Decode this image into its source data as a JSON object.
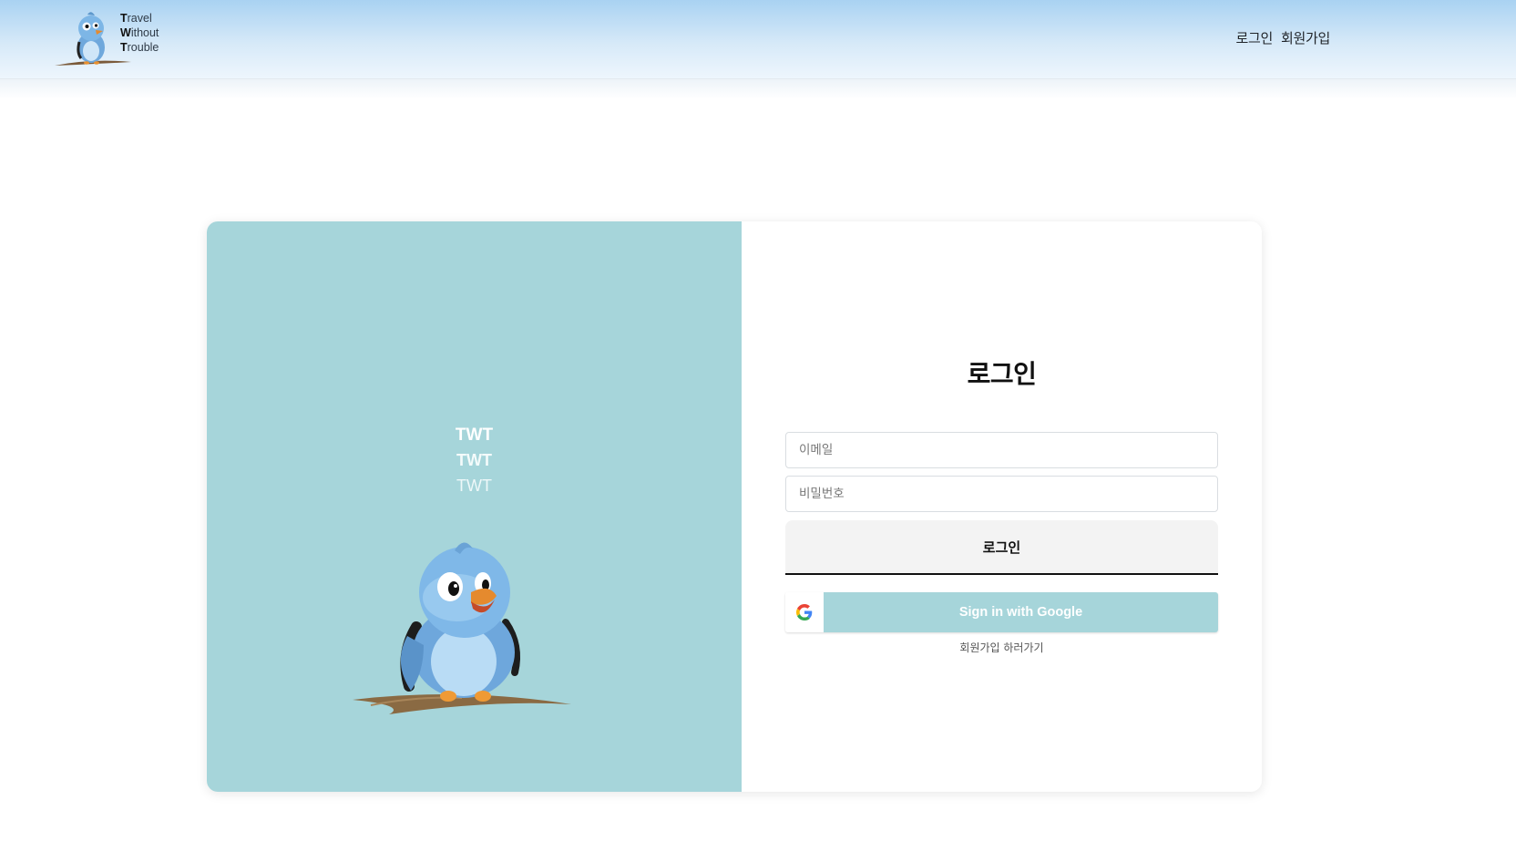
{
  "header": {
    "logo_lines": [
      {
        "cap": "T",
        "rest": "ravel"
      },
      {
        "cap": "W",
        "rest": "ithout"
      },
      {
        "cap": "T",
        "rest": "rouble"
      }
    ],
    "nav": {
      "login": "로그인",
      "signup": "회원가입"
    }
  },
  "hero": {
    "lines": [
      "TWT",
      "TWT",
      "TWT"
    ],
    "bg_color": "#a6d5da"
  },
  "form": {
    "title": "로그인",
    "email_placeholder": "이메일",
    "email_value": "",
    "password_placeholder": "비밀번호",
    "password_value": "",
    "login_button": "로그인",
    "google_button": "Sign in with Google",
    "signup_link": "회원가입 하러가기"
  },
  "icons": {
    "logo": "bluebird-mascot-icon",
    "google": "google-g-icon"
  }
}
